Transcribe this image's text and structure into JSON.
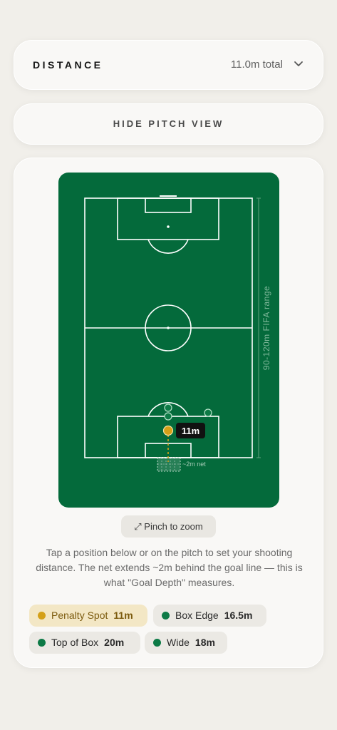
{
  "distance": {
    "label": "DISTANCE",
    "value": "11.0m total",
    "icon": "chevron-down-icon"
  },
  "pitch_toggle": {
    "label": "HIDE PITCH VIEW"
  },
  "pitch": {
    "side_label": "90-120m FIFA range",
    "marker_label": "11m",
    "net_label": "~2m net",
    "colors": {
      "grass": "#046a3b",
      "lines": "#ffffff",
      "selected": "#d4a018",
      "option": "#0d7a46"
    }
  },
  "zoom": {
    "label": "⤢ Pinch to zoom"
  },
  "help_text": "Tap a position below or on the pitch to set your shooting distance. The net extends ~2m behind the goal line — this is what \"Goal Depth\" measures.",
  "presets": [
    {
      "name": "Penalty Spot",
      "distance": "11m",
      "selected": true
    },
    {
      "name": "Box Edge",
      "distance": "16.5m",
      "selected": false
    },
    {
      "name": "Top of Box",
      "distance": "20m",
      "selected": false
    },
    {
      "name": "Wide",
      "distance": "18m",
      "selected": false
    }
  ]
}
